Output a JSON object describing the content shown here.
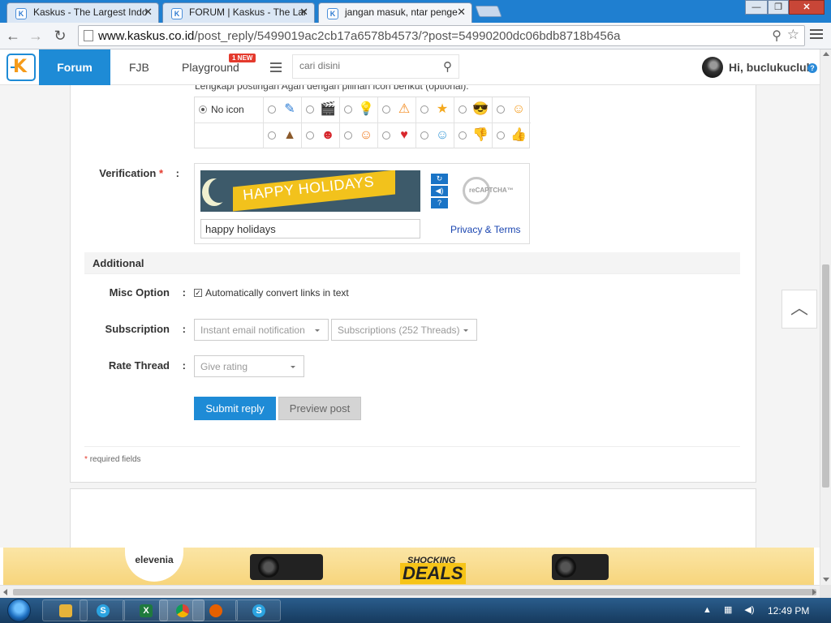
{
  "browser": {
    "tabs": [
      {
        "title": "Kaskus - The Largest Indo",
        "active": false
      },
      {
        "title": "FORUM | Kaskus - The Lar",
        "active": false
      },
      {
        "title": "jangan masuk, ntar penge",
        "active": true
      }
    ],
    "url_host": "www.kaskus.co.id",
    "url_path": "/post_reply/5499019ac2cb17a6578b4573/?post=54990200dc06bdb8718b456a"
  },
  "header": {
    "nav": [
      "Forum",
      "FJB",
      "Playground"
    ],
    "new_badge": "1 NEW",
    "search_placeholder": "cari disini",
    "greeting": "Hi, buclukucluk"
  },
  "form": {
    "cut_text": "Lengkapi postingan Agan dengan pilihan icon berikut (optional).",
    "no_icon_label": "No icon",
    "icons_row1": [
      "pencil-icon",
      "clapper-icon",
      "lightbulb-icon",
      "warning-icon",
      "star-icon",
      "cool-face-icon",
      "smile-face-icon"
    ],
    "icons_row2": [
      "poop-icon",
      "grin-face-icon",
      "laugh-face-icon",
      "heart-icon",
      "blue-face-icon",
      "thumbs-down-icon",
      "thumbs-up-icon"
    ],
    "verification_label": "Verification",
    "required_mark": "*",
    "captcha_image_text": "HAPPY HOLIDAYS",
    "captcha_value": "happy holidays",
    "recaptcha_text": "reCAPTCHA™",
    "privacy_link": "Privacy & Terms",
    "additional_title": "Additional",
    "misc_label": "Misc Option",
    "misc_checkbox_label": "Automatically convert links in text",
    "misc_checked": true,
    "subscription_label": "Subscription",
    "subscription_select1": "Instant email notification",
    "subscription_select2": "Subscriptions (252 Threads)",
    "rate_label": "Rate Thread",
    "rate_select": "Give rating",
    "submit_label": "Submit reply",
    "preview_label": "Preview post",
    "required_note": "required fields"
  },
  "ad": {
    "brand": "elevenia",
    "deal_top": "SHOCKING",
    "deal_main": "DEALS"
  },
  "taskbar": {
    "clock": "12:49 PM"
  },
  "colors": {
    "accent": "#1e8bd6",
    "required": "#e43a2d",
    "link": "#1a45b0"
  }
}
